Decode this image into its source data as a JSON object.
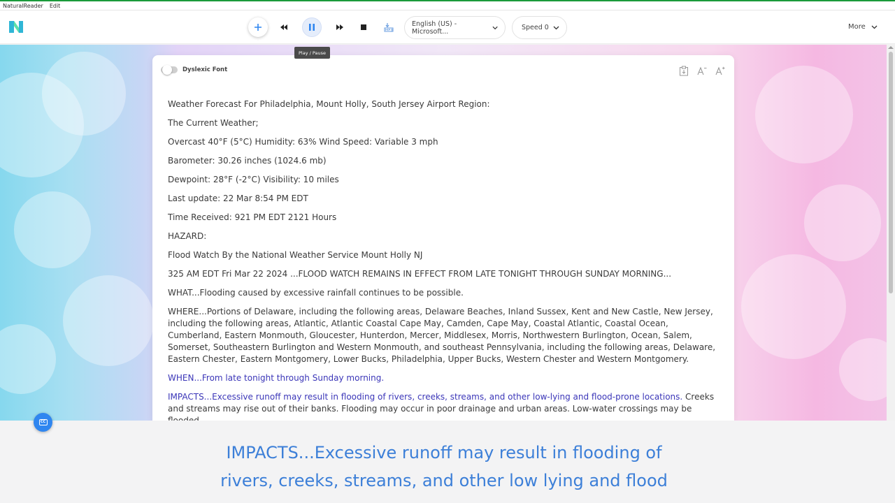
{
  "app": {
    "menu": [
      "NaturalReader",
      "Edit"
    ]
  },
  "toolbar": {
    "voice_label": "English (US) - Microsoft...",
    "speed_label": "Speed 0",
    "more_label": "More",
    "tooltip": "Play / Pause"
  },
  "doc": {
    "dyslexic_label": "Dyslexic Font",
    "paragraphs": [
      "Weather Forecast For Philadelphia, Mount Holly, South Jersey Airport Region:",
      "The Current Weather;",
      "Overcast 40°F (5°C) Humidity: 63% Wind Speed: Variable 3 mph",
      "Barometer: 30.26 inches (1024.6 mb)",
      "Dewpoint: 28°F (-2°C) Visibility: 10 miles",
      "Last update: 22 Mar 8:54 PM EDT",
      "Time Received: 921 PM EDT 2121 Hours",
      "HAZARD:",
      "Flood Watch By the National Weather Service Mount Holly NJ",
      "325 AM EDT Fri Mar 22 2024 ...FLOOD WATCH REMAINS IN EFFECT FROM LATE TONIGHT THROUGH SUNDAY MORNING...",
      "WHAT...Flooding caused by excessive rainfall continues to be possible.",
      "WHERE...Portions of Delaware, including the following areas, Delaware Beaches, Inland Sussex, Kent and New Castle, New Jersey, including the following areas, Atlantic, Atlantic Coastal Cape May, Camden, Cape May, Coastal Atlantic, Coastal Ocean, Cumberland, Eastern Monmouth, Gloucester, Hunterdon, Mercer, Middlesex, Morris, Northwestern Burlington, Ocean, Salem, Somerset, Southeastern Burlington and Western Monmouth, and southeast Pennsylvania, including the following areas, Delaware, Eastern Chester, Eastern Montgomery, Lower Bucks, Philadelphia, Upper Bucks, Western Chester and Western Montgomery.",
      "WHEN...From late tonight through Sunday morning."
    ],
    "impacts_highlight": "IMPACTS...Excessive runoff may result in flooding of rivers, creeks, streams, and other low-lying and flood-prone locations.",
    "impacts_rest": " Creeks and streams may rise out of their banks. Flooding may occur in poor drainage and urban areas. Low-water crossings may be flooded."
  },
  "captions": {
    "line1": "IMPACTS...Excessive runoff may result in flooding of",
    "line2": "rivers, creeks, streams, and other low lying and flood"
  },
  "colors": {
    "accent": "#2f86f0",
    "read_highlight": "#3b36b8",
    "caption": "#3c7fd8"
  }
}
